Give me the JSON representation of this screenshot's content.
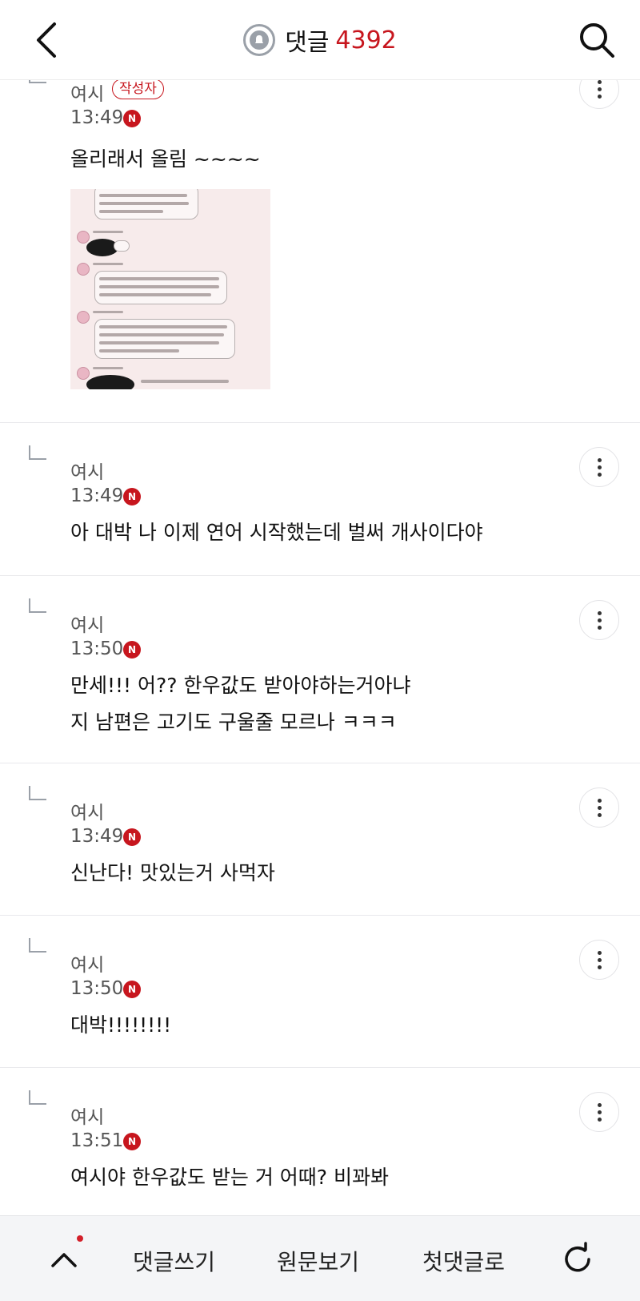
{
  "header": {
    "back_icon": "chevron-left-icon",
    "bell_icon": "bell-icon",
    "title": "댓글",
    "count": "4392",
    "search_icon": "search-icon"
  },
  "comments": [
    {
      "author": "여시",
      "badge": "작성자",
      "time": "13:49",
      "new_mark": "N",
      "text": "올리래서 올림 ~~~~",
      "has_image": true
    },
    {
      "author": "여시",
      "time": "13:49",
      "new_mark": "N",
      "text": "아 대박 나 이제 연어 시작했는데 벌써 개사이다야"
    },
    {
      "author": "여시",
      "time": "13:50",
      "new_mark": "N",
      "text": "만세!!! 어?? 한우값도 받아야하는거아냐\n지 남편은 고기도 구울줄 모르나 ㅋㅋㅋ"
    },
    {
      "author": "여시",
      "time": "13:49",
      "new_mark": "N",
      "text": "신난다! 맛있는거 사먹자"
    },
    {
      "author": "여시",
      "time": "13:50",
      "new_mark": "N",
      "text": "대박!!!!!!!!"
    },
    {
      "author": "여시",
      "time": "13:51",
      "new_mark": "N",
      "text": "여시야 한우값도 받는 거 어때? 비꽈봐"
    }
  ],
  "bottom_bar": {
    "up_icon": "chevron-up-icon",
    "write_comment": "댓글쓰기",
    "view_original": "원문보기",
    "first_comment": "첫댓글로",
    "refresh_icon": "refresh-icon"
  },
  "colors": {
    "accent": "#c7161e",
    "muted_text": "#555555",
    "divider": "#e9e9ec",
    "bottom_bar_bg": "#f4f5f7"
  }
}
